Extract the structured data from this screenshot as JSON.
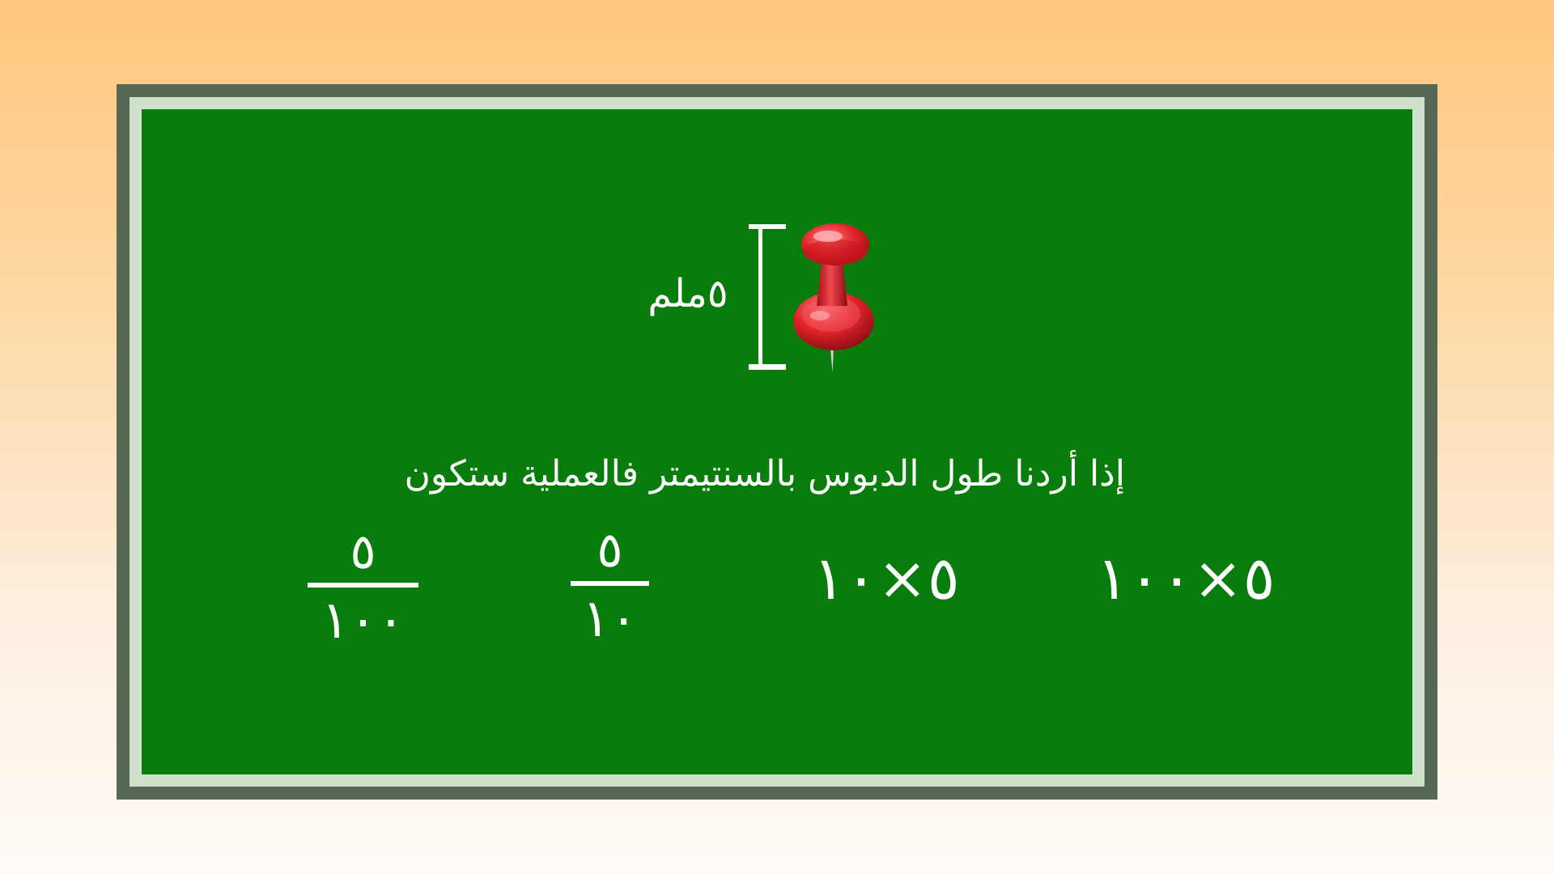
{
  "board": {
    "colors": {
      "frame_outer": "#566855",
      "frame_inner": "#cfe1cb",
      "surface": "#087d0c",
      "chalk": "#ffffff",
      "pin": "#e0242c"
    },
    "icon": "red-pushpin",
    "measurement": {
      "label": "٥ملم"
    },
    "question": "إذا أردنا طول الدبوس بالسنتيمتر فالعملية ستكون",
    "options": [
      {
        "expression": "٥×١٠٠"
      },
      {
        "expression": "٥×١٠"
      },
      {
        "numerator": "٥",
        "denominator": "١٠"
      },
      {
        "numerator": "٥",
        "denominator": "١٠٠"
      }
    ]
  }
}
